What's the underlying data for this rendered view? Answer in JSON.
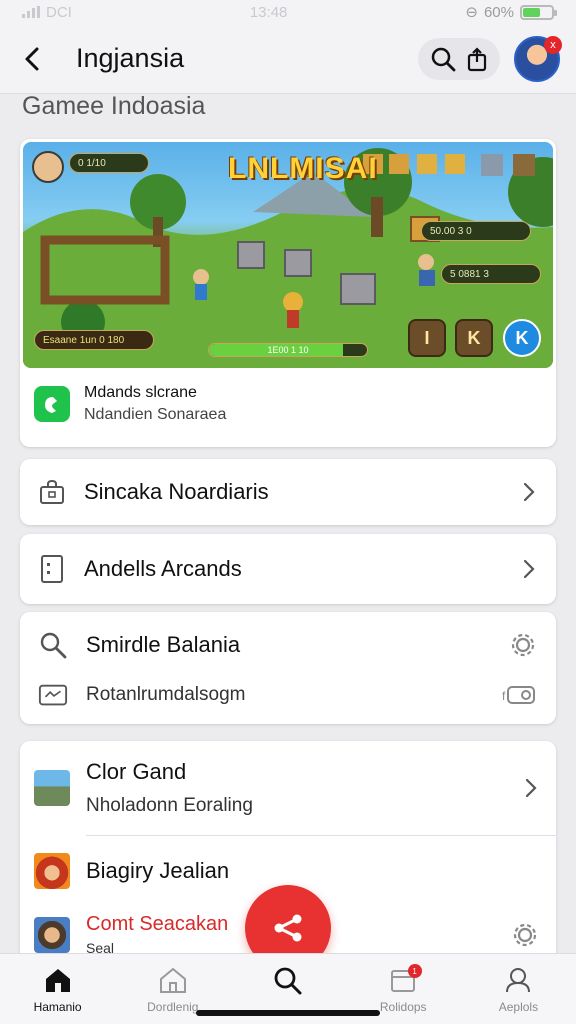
{
  "status_bar": {
    "carrier": "DCI",
    "time": "13:48",
    "battery": "60%",
    "battery_level": 0.6
  },
  "header": {
    "title": "Ingjansia",
    "avatar_badge": "x"
  },
  "section_title": "Gamee Indoasia",
  "game_card": {
    "banner": {
      "title": "LNLMISAI",
      "hud_top_left": "0 1/10",
      "hud_right_1": "50.00 3 0",
      "hud_right_2": "5 0881 3",
      "hud_bottom_left": "Esaane 1un   0 180",
      "hud_bar_label": "1E00 1 10",
      "hud_bar_fill": 0.85,
      "btn_1": "I",
      "btn_2": "K",
      "btn_3": "K"
    },
    "name": "Mdands slcrane",
    "subtitle": "Ndandien Sonaraea"
  },
  "rows": [
    {
      "label": "Sincaka Noardiaris",
      "icon": "bag-icon"
    },
    {
      "label": "Andells Arcands",
      "icon": "document-icon"
    }
  ],
  "multi_card": {
    "title": "Smirdle Balania",
    "subtitle": "Rotanlrumdalsogm"
  },
  "list_items": [
    {
      "title": "Clor Gand",
      "subtitle": "Nholadonn Eoraling",
      "thumb": "landscape"
    },
    {
      "title": "Biagiry Jealian",
      "thumb": "fire"
    },
    {
      "title": "Comt Seacakan",
      "subtitle": "Seal",
      "thumb": "hero"
    }
  ],
  "bottom_nav": [
    {
      "label": "Hamanio",
      "icon": "home-icon",
      "active": true
    },
    {
      "label": "Dordlenig",
      "icon": "home-outline-icon"
    },
    {
      "label": "",
      "icon": "search-icon"
    },
    {
      "label": "Rolidops",
      "icon": "calendar-icon",
      "badge": "1"
    },
    {
      "label": "Aeplols",
      "icon": "profile-icon"
    }
  ],
  "colors": {
    "accent": "#e83232",
    "green": "#1fc24a",
    "background": "#ececef"
  }
}
